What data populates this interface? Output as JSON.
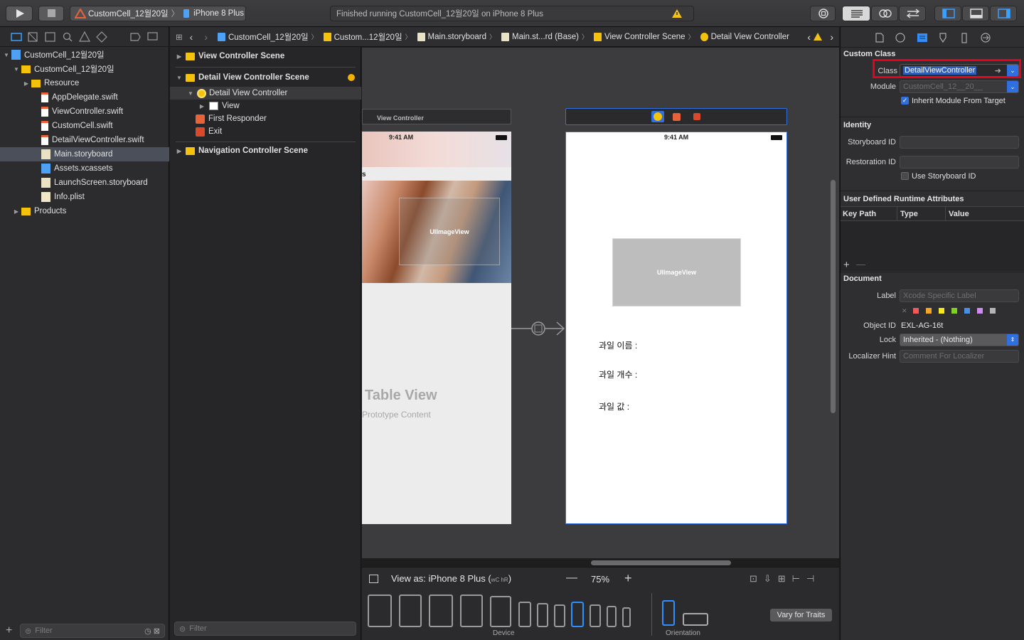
{
  "toolbar": {
    "scheme_name": "CustomCell_12월20일",
    "device_name": "iPhone 8 Plus",
    "status_text": "Finished running CustomCell_12월20일 on iPhone 8 Plus"
  },
  "navigator": {
    "items": [
      {
        "label": "CustomCell_12월20일",
        "kind": "project"
      },
      {
        "label": "CustomCell_12월20일",
        "kind": "folder"
      },
      {
        "label": "Resource",
        "kind": "folder"
      },
      {
        "label": "AppDelegate.swift",
        "kind": "swift"
      },
      {
        "label": "ViewController.swift",
        "kind": "swift"
      },
      {
        "label": "CustomCell.swift",
        "kind": "swift"
      },
      {
        "label": "DetailViewController.swift",
        "kind": "swift"
      },
      {
        "label": "Main.storyboard",
        "kind": "storyboard"
      },
      {
        "label": "Assets.xcassets",
        "kind": "assets"
      },
      {
        "label": "LaunchScreen.storyboard",
        "kind": "storyboard"
      },
      {
        "label": "Info.plist",
        "kind": "plist"
      },
      {
        "label": "Products",
        "kind": "folder"
      }
    ],
    "filter_placeholder": "Filter"
  },
  "jumpbar": {
    "crumbs": [
      "CustomCell_12월20일",
      "Custom...12월20일",
      "Main.storyboard",
      "Main.st...rd (Base)",
      "View Controller Scene",
      "Detail View Controller"
    ]
  },
  "outline": {
    "items": [
      "View Controller Scene",
      "Detail View Controller Scene",
      "Detail View Controller",
      "View",
      "First Responder",
      "Exit",
      "Navigation Controller Scene"
    ],
    "filter_placeholder": "Filter"
  },
  "canvas": {
    "left_scene_title": "View Controller",
    "time": "9:41 AM",
    "left_partial_text": "s",
    "imageview_label": "UIImageView",
    "table_view_title": "Table View",
    "table_view_subtitle": "Prototype Content",
    "detail_time": "9:41 AM",
    "detail_imageview_label": "UIImageView",
    "labels": [
      "과일 이름 :",
      "과일 개수 :",
      "과일 값 :"
    ]
  },
  "bottom": {
    "view_as": "View as: iPhone 8 Plus (",
    "traits": "wC hR",
    "view_as_end": ")",
    "zoom": "75%",
    "device_label": "Device",
    "orientation_label": "Orientation",
    "vary_button": "Vary for Traits"
  },
  "inspector": {
    "custom_class_header": "Custom Class",
    "class_label": "Class",
    "class_value": "DetailViewController",
    "module_label": "Module",
    "module_placeholder": "CustomCell_12__20__",
    "inherit_label": "Inherit Module From Target",
    "identity_header": "Identity",
    "storyboard_id_label": "Storyboard ID",
    "restoration_id_label": "Restoration ID",
    "use_storyboard_id_label": "Use Storyboard ID",
    "runtime_header": "User Defined Runtime Attributes",
    "col_keypath": "Key Path",
    "col_type": "Type",
    "col_value": "Value",
    "document_header": "Document",
    "doc_label_label": "Label",
    "doc_label_placeholder": "Xcode Specific Label",
    "object_id_label": "Object ID",
    "object_id_value": "EXL-AG-16t",
    "lock_label": "Lock",
    "lock_value": "Inherited - (Nothing)",
    "localizer_label": "Localizer Hint",
    "localizer_placeholder": "Comment For Localizer",
    "highlight_color": "#e8001c",
    "accent_color": "#2f6fe0"
  }
}
